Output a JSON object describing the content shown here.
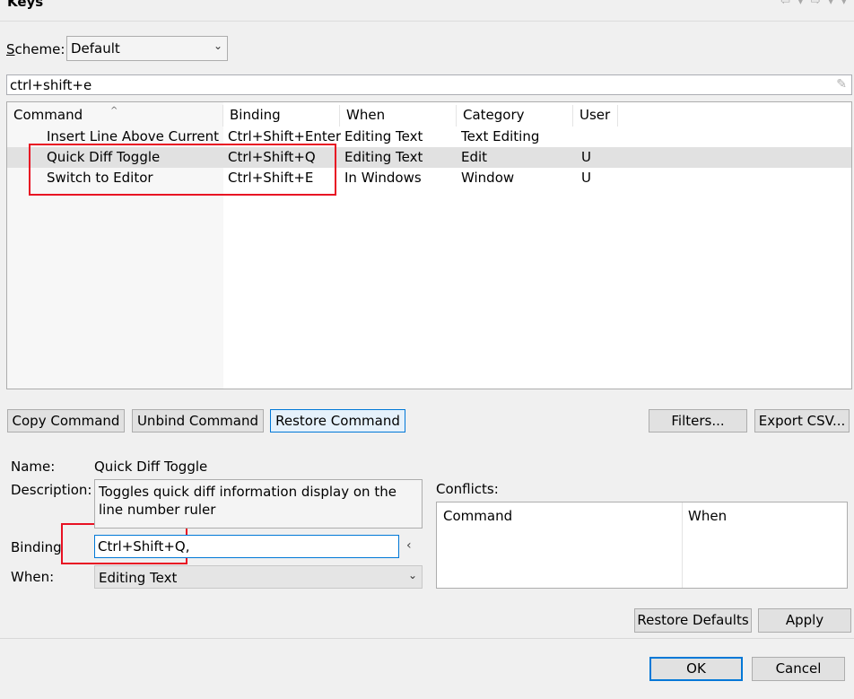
{
  "window": {
    "title": "Keys",
    "header_icons": "⇦ ▾ ⇨ ▾ ▾"
  },
  "scheme": {
    "label": "Scheme:",
    "value": "Default"
  },
  "filter": {
    "value": "ctrl+shift+e"
  },
  "table": {
    "columns": [
      "Command",
      "Binding",
      "When",
      "Category",
      "User"
    ],
    "rows": [
      [
        "Insert Line Above Current Line",
        "Ctrl+Shift+Enter",
        "Editing Text",
        "Text Editing",
        ""
      ],
      [
        "Quick Diff Toggle",
        "Ctrl+Shift+Q",
        "Editing Text",
        "Edit",
        "U"
      ],
      [
        "Switch to Editor",
        "Ctrl+Shift+E",
        "In Windows",
        "Window",
        "U"
      ]
    ],
    "selected_row": 1
  },
  "buttons": {
    "copy": "Copy Command",
    "unbind": "Unbind Command",
    "restore": "Restore Command",
    "filters": "Filters...",
    "export": "Export CSV...",
    "restore_defaults": "Restore Defaults",
    "apply": "Apply",
    "ok": "OK",
    "cancel": "Cancel"
  },
  "details": {
    "name_label": "Name:",
    "name_value": "Quick Diff Toggle",
    "description_label": "Description:",
    "description_value": "Toggles quick diff information display on the line number ruler",
    "binding_label": "Binding",
    "binding_value": "Ctrl+Shift+Q,",
    "when_label": "When:",
    "when_value": "Editing Text"
  },
  "conflicts": {
    "label": "Conflicts:",
    "columns": [
      "Command",
      "When"
    ]
  },
  "colors": {
    "highlight": "#e81123",
    "accent": "#0078d7",
    "selected_row": "#e1e1e1"
  },
  "icons": {
    "clear": "eraser-icon",
    "dropdown": "chevron-down-icon",
    "binding_menu": "chevron-left-icon"
  }
}
